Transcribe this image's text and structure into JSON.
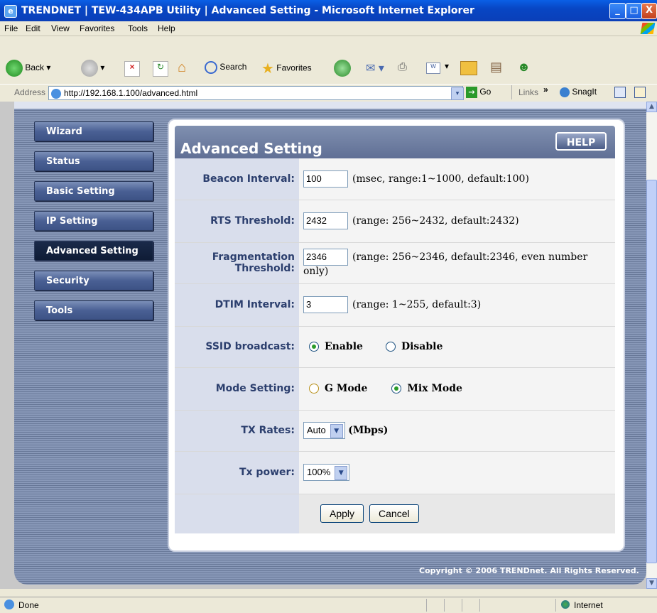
{
  "window": {
    "title": "TRENDNET  |  TEW-434APB Utility  |  Advanced Setting - Microsoft Internet Explorer",
    "controls": {
      "minimize": "_",
      "maximize": "□",
      "close": "X"
    }
  },
  "menubar": {
    "items": [
      "File",
      "Edit",
      "View",
      "Favorites",
      "Tools",
      "Help"
    ]
  },
  "toolbar": {
    "back_label": "Back",
    "search_label": "Search",
    "favorites_label": "Favorites"
  },
  "addressbar": {
    "label": "Address",
    "url": "http://192.168.1.100/advanced.html",
    "go_label": "Go",
    "links_label": "Links",
    "links_chevron": "»",
    "snagit_label": "SnagIt"
  },
  "sidebar": {
    "items": [
      {
        "label": "Wizard",
        "active": false
      },
      {
        "label": "Status",
        "active": false
      },
      {
        "label": "Basic Setting",
        "active": false
      },
      {
        "label": "IP Setting",
        "active": false
      },
      {
        "label": "Advanced Setting",
        "active": true
      },
      {
        "label": "Security",
        "active": false
      },
      {
        "label": "Tools",
        "active": false
      }
    ]
  },
  "panel": {
    "title": "Advanced Setting",
    "help_label": "HELP"
  },
  "settings": {
    "beacon": {
      "label": "Beacon Interval:",
      "value": "100",
      "hint": "(msec, range:1~1000, default:100)"
    },
    "rts": {
      "label": "RTS Threshold:",
      "value": "2432",
      "hint": "(range: 256~2432, default:2432)"
    },
    "frag": {
      "label_line1": "Fragmentation",
      "label_line2": "Threshold:",
      "value": "2346",
      "hint": "(range: 256~2346, default:2346, even number only)"
    },
    "dtim": {
      "label": "DTIM Interval:",
      "value": "3",
      "hint": "(range: 1~255, default:3)"
    },
    "ssid": {
      "label": "SSID broadcast:",
      "enable_label": "Enable",
      "disable_label": "Disable",
      "selected": "Enable"
    },
    "mode": {
      "label": "Mode Setting:",
      "g_label": "G Mode",
      "mix_label": "Mix Mode",
      "selected": "Mix Mode"
    },
    "txrate": {
      "label": "TX Rates:",
      "value": "Auto",
      "unit": "(Mbps)"
    },
    "txpower": {
      "label": "Tx power:",
      "value": "100%"
    },
    "apply_label": "Apply",
    "cancel_label": "Cancel"
  },
  "footer": {
    "copyright": "Copyright © 2006 TRENDnet. All Rights Reserved."
  },
  "statusbar": {
    "status": "Done",
    "zone": "Internet"
  }
}
